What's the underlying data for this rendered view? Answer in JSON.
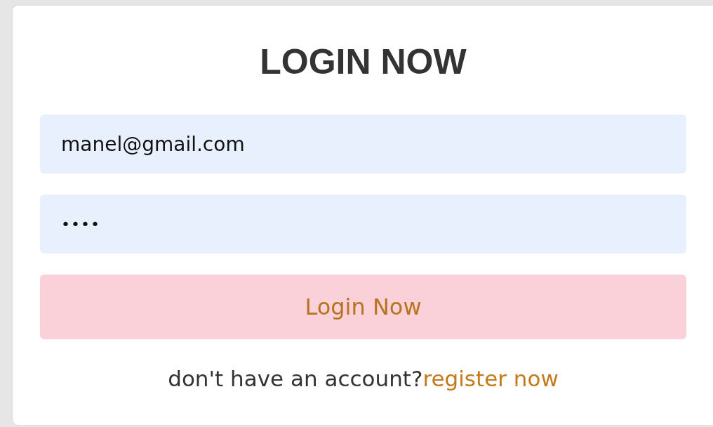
{
  "title": "LOGIN NOW",
  "fields": [
    {
      "kind": "email",
      "value": "manel@gmail.com"
    },
    {
      "kind": "password",
      "value": "••••"
    }
  ],
  "submit_button": "Login Now",
  "footer": {
    "text": "don't have an account?",
    "link": "register now"
  }
}
